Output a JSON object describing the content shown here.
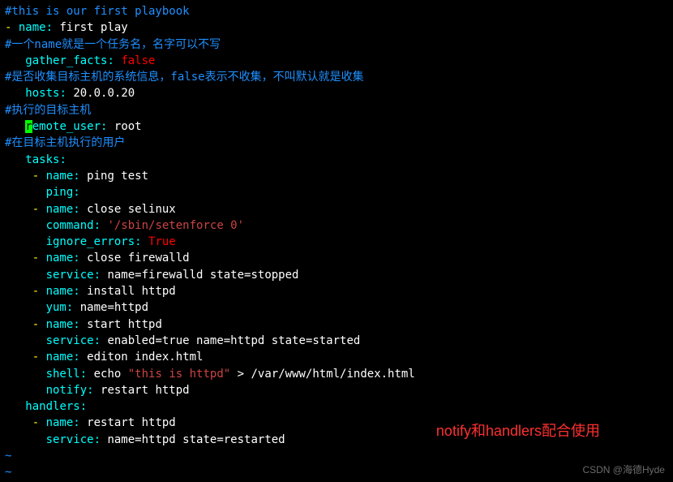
{
  "lines": {
    "c1": "#this is our first playbook",
    "l2_dash": "- ",
    "l2_key": "name",
    "l2_colon": ": ",
    "l2_val": "first play",
    "c2": "#一个name就是一个任务名，名字可以不写",
    "l4_indent": "   ",
    "l4_key": "gather_facts",
    "l4_colon": ": ",
    "l4_val": "false",
    "c3": "#是否收集目标主机的系统信息，false表示不收集，不叫默认就是收集",
    "l6_indent": "   ",
    "l6_key": "hosts",
    "l6_colon": ": ",
    "l6_val": "20.0.0.20",
    "c4": "#执行的目标主机",
    "l8_indent": "   ",
    "l8_cursor": "r",
    "l8_key": "emote_user",
    "l8_colon": ": ",
    "l8_val": "root",
    "c5": "#在目标主机执行的用户",
    "l10_indent": "   ",
    "l10_key": "tasks",
    "l10_colon": ":",
    "t1_indent": "    ",
    "t1_dash": "- ",
    "t1_key": "name",
    "t1_colon": ": ",
    "t1_val": "ping test",
    "t1b_indent": "      ",
    "t1b_key": "ping",
    "t1b_colon": ":",
    "t2_indent": "    ",
    "t2_dash": "- ",
    "t2_key": "name",
    "t2_colon": ": ",
    "t2_val": "close selinux",
    "t2b_indent": "      ",
    "t2b_key": "command",
    "t2b_colon": ": ",
    "t2b_val": "'/sbin/setenforce 0'",
    "t2c_indent": "      ",
    "t2c_key": "ignore_errors",
    "t2c_colon": ": ",
    "t2c_val": "True",
    "t3_indent": "    ",
    "t3_dash": "- ",
    "t3_key": "name",
    "t3_colon": ": ",
    "t3_val": "close firewalld",
    "t3b_indent": "      ",
    "t3b_key": "service",
    "t3b_colon": ": ",
    "t3b_val": "name=firewalld state=stopped",
    "t4_indent": "    ",
    "t4_dash": "- ",
    "t4_key": "name",
    "t4_colon": ": ",
    "t4_val": "install httpd",
    "t4b_indent": "      ",
    "t4b_key": "yum",
    "t4b_colon": ": ",
    "t4b_val": "name=httpd",
    "t5_indent": "    ",
    "t5_dash": "- ",
    "t5_key": "name",
    "t5_colon": ": ",
    "t5_val": "start httpd",
    "t5b_indent": "      ",
    "t5b_key": "service",
    "t5b_colon": ": ",
    "t5b_val": "enabled=true name=httpd state=started",
    "t6_indent": "    ",
    "t6_dash": "- ",
    "t6_key": "name",
    "t6_colon": ": ",
    "t6_val": "editon index.html",
    "t6b_indent": "      ",
    "t6b_key": "shell",
    "t6b_colon": ": ",
    "t6b_val1": "echo ",
    "t6b_val2": "\"this is httpd\"",
    "t6b_val3": " > /var/www/html/index.html",
    "t6c_indent": "      ",
    "t6c_key": "notify",
    "t6c_colon": ": ",
    "t6c_val": "restart httpd",
    "h_indent": "   ",
    "h_key": "handlers",
    "h_colon": ":",
    "h1_indent": "    ",
    "h1_dash": "- ",
    "h1_key": "name",
    "h1_colon": ": ",
    "h1_val": "restart httpd",
    "h1b_indent": "      ",
    "h1b_key": "service",
    "h1b_colon": ": ",
    "h1b_val": "name=httpd state=restarted",
    "tilde": "~"
  },
  "annotation": "notify和handlers配合使用",
  "watermark": "CSDN @海德Hyde"
}
